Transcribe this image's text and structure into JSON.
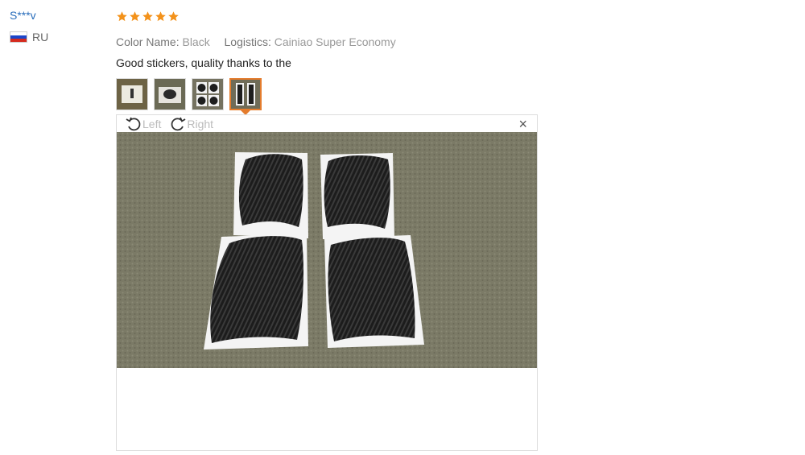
{
  "review": {
    "user": {
      "name": "S***v",
      "country": "RU",
      "flag_colors": [
        "#ffffff",
        "#1c46c9",
        "#d52b1e"
      ]
    },
    "rating": 5,
    "meta": {
      "color_label": "Color Name:",
      "color_value": "Black",
      "logistics_label": "Logistics:",
      "logistics_value": "Cainiao Super Economy"
    },
    "text": "Good stickers, quality thanks to the",
    "thumbnails": [
      {
        "name": "thumb-1",
        "active": false
      },
      {
        "name": "thumb-2",
        "active": false
      },
      {
        "name": "thumb-3",
        "active": false
      },
      {
        "name": "thumb-4",
        "active": true
      }
    ],
    "viewer": {
      "rotate_left_label": "Left",
      "rotate_right_label": "Right",
      "close_symbol": "×"
    }
  },
  "colors": {
    "star": "#f3921b",
    "accent": "#e47c2d",
    "link": "#2a6ebb"
  }
}
